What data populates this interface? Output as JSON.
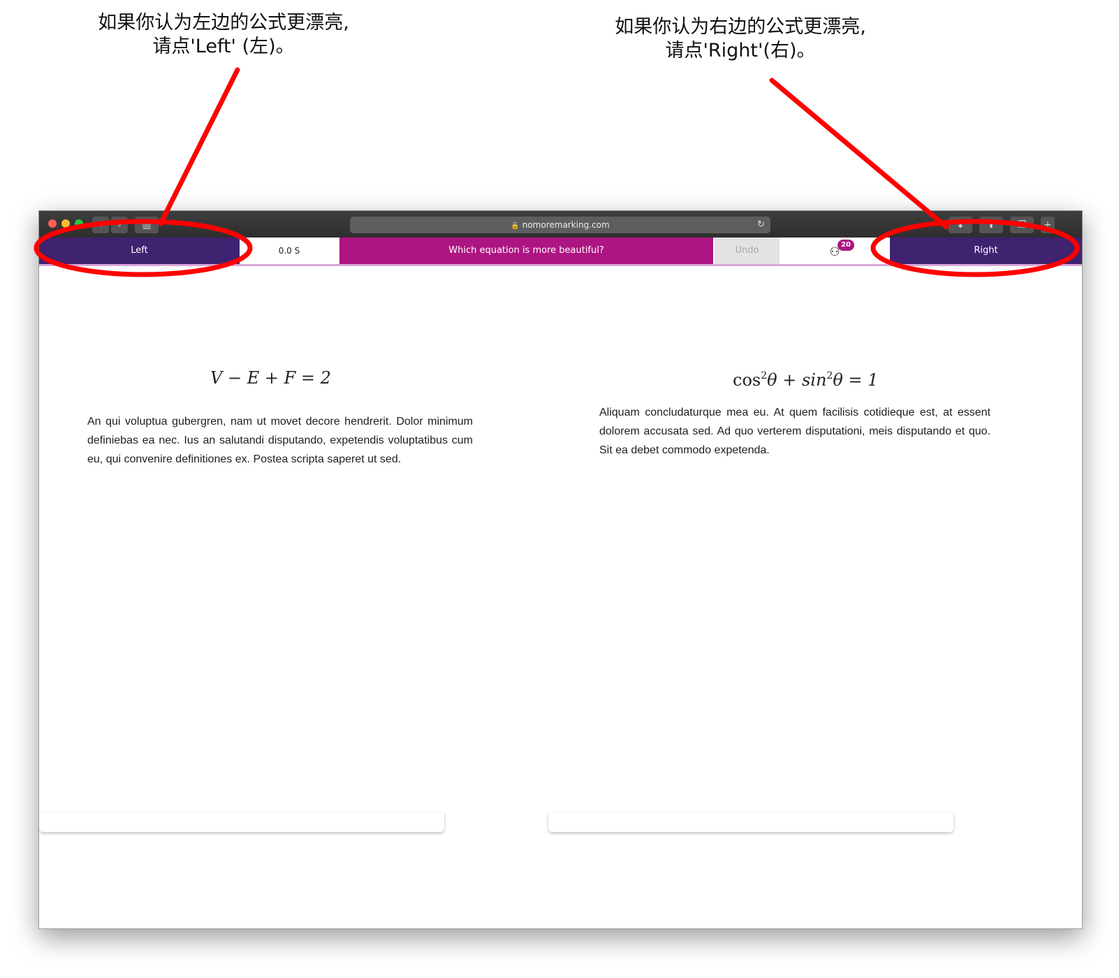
{
  "annotations": {
    "left_caption_line1": "如果你认为左边的公式更漂亮,",
    "left_caption_line2": "请点'Left' (左)。",
    "right_caption_line1": "如果你认为右边的公式更漂亮,",
    "right_caption_line2": "请点'Right'(右)。",
    "highlight_color": "#ff0000"
  },
  "browser": {
    "url": "nomoremarking.com",
    "lock_icon": "lock-icon",
    "reload_icon": "reload-icon"
  },
  "toolbar": {
    "left_label": "Left",
    "timer": "0.0 S",
    "question": "Which equation is more beautiful?",
    "undo_label": "Undo",
    "badge_count": "20",
    "right_label": "Right",
    "accent_purple": "#3f2270",
    "accent_magenta": "#ad1582"
  },
  "left_panel": {
    "equation": "V − E + F = 2",
    "text": "An qui voluptua gubergren, nam ut movet decore hendrerit. Dolor minimum definiebas ea nec. Ius an salutandi disputando, expetendis voluptatibus cum eu, qui convenire definitiones ex. Postea scripta saperet ut sed."
  },
  "right_panel": {
    "eq_cos": "cos",
    "eq_sup1": "2",
    "eq_mid": "θ + sin",
    "eq_sup2": "2",
    "eq_end": "θ = 1",
    "text": "Aliquam concludaturque mea eu. At quem facilisis cotidieque est, at essent dolorem accusata sed. Ad quo verterem disputationi, meis disputando et quo. Sit ea debet commodo expetenda."
  }
}
